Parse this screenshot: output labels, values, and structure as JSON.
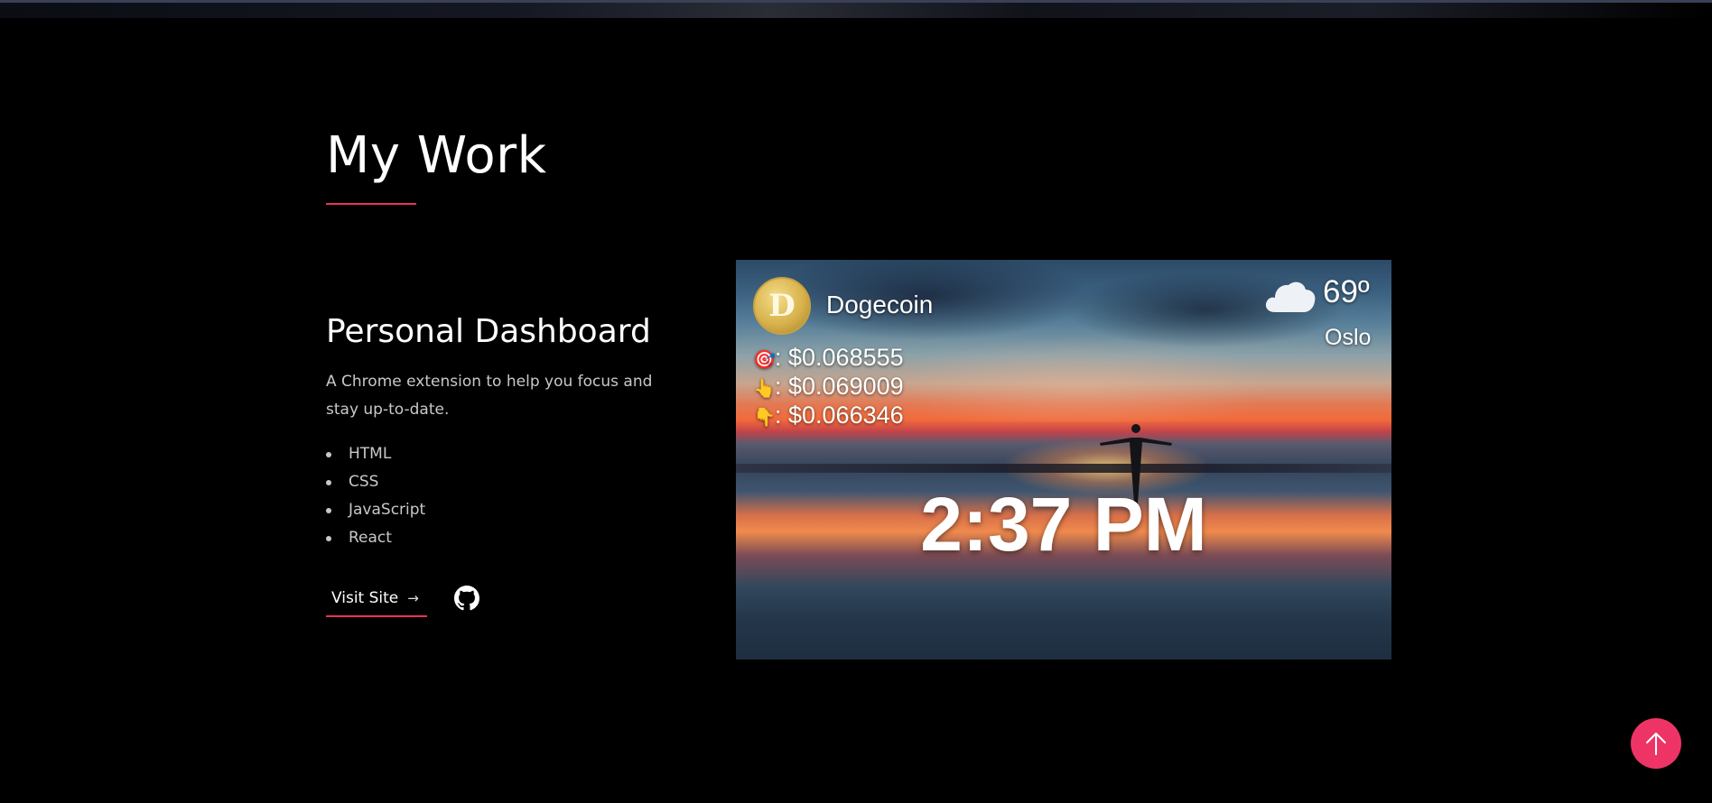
{
  "section": {
    "title": "My Work"
  },
  "project": {
    "title": "Personal Dashboard",
    "description": "A Chrome extension to help you focus and stay up-to-date.",
    "tech": [
      "HTML",
      "CSS",
      "JavaScript",
      "React"
    ],
    "visit_label": "Visit Site",
    "visit_arrow": "→",
    "github_icon": "github-icon"
  },
  "preview": {
    "coin_name": "Dogecoin",
    "prices": [
      {
        "emoji": "🎯",
        "value": ": $0.068555"
      },
      {
        "emoji": "👆",
        "value": ": $0.069009"
      },
      {
        "emoji": "👇",
        "value": ": $0.066346"
      }
    ],
    "temperature": "69º",
    "city": "Oslo",
    "time": "2:37 PM",
    "weather_icon": "cloud-icon"
  },
  "colors": {
    "accent": "#e8325a",
    "scroll_button": "#ee3466",
    "background": "#000000"
  },
  "scroll_top_icon": "arrow-up-icon"
}
